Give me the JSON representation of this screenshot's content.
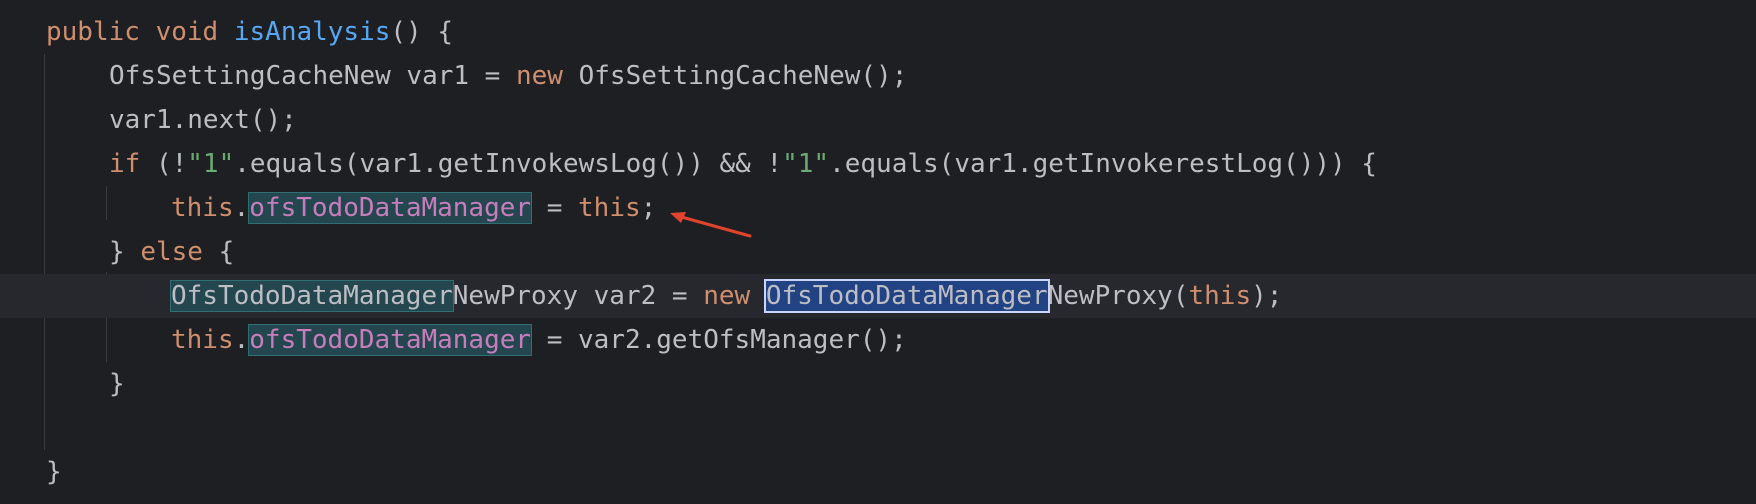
{
  "editor": {
    "lines": [
      {
        "parts": [
          "public",
          " ",
          "void",
          " ",
          "isAnalysis",
          "() {"
        ]
      },
      {
        "parts": [
          "OfsSettingCacheNew var1 = ",
          "new",
          " OfsSettingCacheNew();"
        ]
      },
      {
        "parts": [
          "var1.next();"
        ]
      },
      {
        "parts": [
          "if",
          " (!",
          "\"1\"",
          ".equals(var1.getInvokewsLog()) && !",
          "\"1\"",
          ".equals(var1.getInvokerestLog())) {"
        ]
      },
      {
        "parts": [
          "this",
          ".",
          "ofsTodoDataManager",
          " = ",
          "this",
          ";"
        ]
      },
      {
        "parts": [
          "} ",
          "else",
          " {"
        ]
      },
      {
        "parts": [
          "OfsTodoDataManager",
          "NewProxy var2 = ",
          "new",
          " ",
          "OfsTodoDataManager",
          "NewProxy(",
          "this",
          ");"
        ]
      },
      {
        "parts": [
          "this",
          ".",
          "ofsTodoDataManager",
          " = var2.getOfsManager();"
        ]
      },
      {
        "parts": [
          "}"
        ]
      },
      {
        "parts": [
          "}"
        ]
      }
    ]
  },
  "colors": {
    "background": "#1e1f22",
    "keyword": "#cf8e6d",
    "method": "#56a8f5",
    "string": "#6aab73",
    "field": "#c77dbb",
    "default": "#bcbec4",
    "arrow": "#e0442e"
  },
  "annotation": {
    "icon": "arrow-icon"
  }
}
